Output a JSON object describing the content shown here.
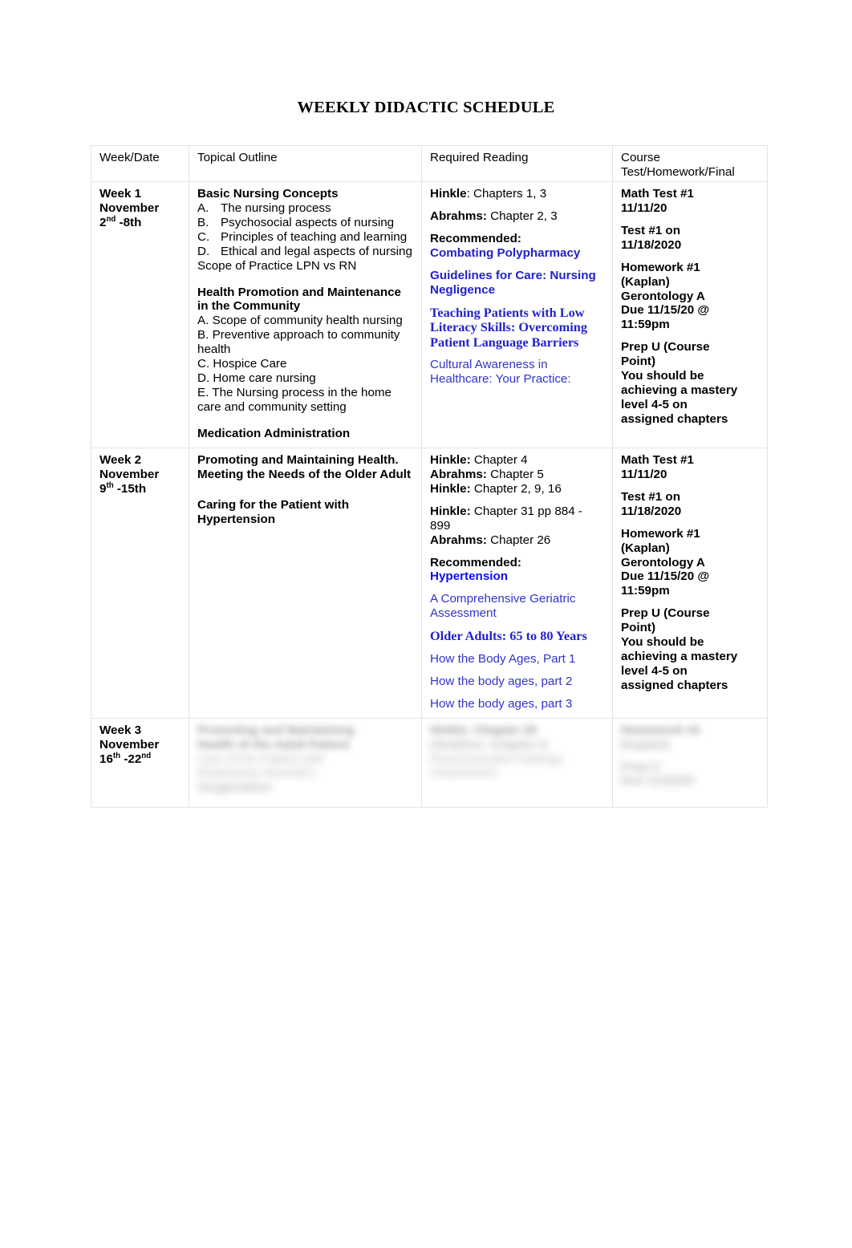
{
  "document": {
    "title": "WEEKLY DIDACTIC SCHEDULE"
  },
  "table": {
    "headers": {
      "col1": "Week/Date",
      "col2": "Topical Outline",
      "col3": "Required Reading",
      "col4_line1": "Course",
      "col4_line2": "Test/Homework/Final"
    },
    "rows": [
      {
        "week": {
          "line1": "Week 1",
          "line2": "November",
          "line3_pre": "2",
          "line3_sup": "nd",
          "line3_post": " -8th"
        },
        "topical": {
          "heading1": "Basic Nursing Concepts",
          "items1": [
            {
              "label": "A.",
              "text": "The nursing process"
            },
            {
              "label": "B.",
              "text": "Psychosocial aspects of nursing"
            },
            {
              "label": "C.",
              "text": "Principles of teaching and learning"
            },
            {
              "label": "D.",
              "text": "Ethical and legal aspects of nursing"
            }
          ],
          "scope": "Scope of Practice LPN vs RN",
          "heading2": "Health Promotion and Maintenance in the Community",
          "items2": [
            "A. Scope of community health nursing",
            "B.  Preventive approach to community health",
            "C.  Hospice Care",
            "D.  Home care nursing",
            "E.  The Nursing process in the home care and community setting"
          ],
          "heading3": "Medication Administration"
        },
        "reading": {
          "line1_bold": "Hinkle",
          "line1_rest": ": Chapters 1, 3",
          "line2_bold": "Abrahms:",
          "line2_rest": " Chapter 2, 3",
          "recommended_label": "Recommended:",
          "link1": "Combating Polypharmacy",
          "link2": "Guidelines for Care: Nursing Negligence",
          "link3": "Teaching Patients with Low Literacy Skills: Overcoming Patient Language Barriers",
          "link4": "Cultural Awareness in Healthcare: Your Practice:"
        },
        "course": {
          "block1_line1": "Math Test #1",
          "block1_line2": "11/11/20",
          "block2_line1": "Test #1 on",
          "block2_line2": "11/18/2020",
          "block3_line1": "Homework #1",
          "block3_line2": "(Kaplan)",
          "block3_line3": "Gerontology A",
          "block3_line4": "Due 11/15/20 @",
          "block3_line5": "11:59pm",
          "block4_line1": "Prep U (Course",
          "block4_line2": "Point)",
          "block4_line3": "You should be",
          "block4_line4": "achieving a mastery",
          "block4_line5": "level 4-5 on",
          "block4_line6": "assigned chapters"
        }
      },
      {
        "week": {
          "line1": "Week 2",
          "line2": "November",
          "line3_pre": "9",
          "line3_sup": "th",
          "line3_post": " -15th"
        },
        "topical": {
          "heading1": "Promoting and Maintaining Health. Meeting the Needs of the Older Adult",
          "heading2": "Caring for the Patient with Hypertension"
        },
        "reading": {
          "line1_bold": "Hinkle:",
          "line1_rest": " Chapter 4",
          "line2_bold": "Abrahms:",
          "line2_rest": " Chapter 5",
          "line3_bold": "Hinkle:",
          "line3_rest": " Chapter 2, 9, 16",
          "line4_bold": "Hinkle:",
          "line4_rest": " Chapter 31 pp 884 - 899",
          "line5_bold": "Abrahms:",
          "line5_rest": " Chapter 26",
          "recommended_label": "Recommended:",
          "link1": "Hypertension",
          "link2": "A Comprehensive Geriatric Assessment",
          "link3": "Older Adults: 65 to 80 Years",
          "link4": "How the Body Ages, Part 1",
          "link5": "How the body ages, part 2",
          "link6": "How the body ages, part 3"
        },
        "course": {
          "block1_line1": "Math Test #1",
          "block1_line2": "11/11/20",
          "block2_line1": "Test #1 on",
          "block2_line2": "11/18/2020",
          "block3_line1": "Homework #1",
          "block3_line2": "(Kaplan)",
          "block3_line3": "Gerontology A",
          "block3_line4": "Due 11/15/20 @",
          "block3_line5": "11:59pm",
          "block4_line1": "Prep U (Course",
          "block4_line2": "Point)",
          "block4_line3": "You should be",
          "block4_line4": "achieving a mastery",
          "block4_line5": "level 4-5 on",
          "block4_line6": "assigned chapters"
        }
      },
      {
        "week": {
          "line1": "Week 3",
          "line2": " November",
          "line3_pre": "16",
          "line3_sup": "th",
          "line3_post": " -22",
          "line3_sup2": "nd"
        },
        "topical": {
          "obscured_1": "Promoting and Maintaining",
          "obscured_2": "Health of the Adult Patient",
          "obscured_3": "Care of the Patient with",
          "obscured_4": "Respiratory Disorders",
          "obscured_5": "Oxygenation"
        },
        "reading": {
          "obscured_1": "Hinkle: Chapter 20",
          "obscured_2": "Abrahms: Chapter 9",
          "obscured_3": "Recommended readings",
          "obscured_4": "Assessment"
        },
        "course": {
          "obscured_1": "Homework #2",
          "obscured_2": "(Kaplan)",
          "obscured_3": "Prep U",
          "obscured_4": "Due 11/22/20"
        }
      }
    ]
  }
}
